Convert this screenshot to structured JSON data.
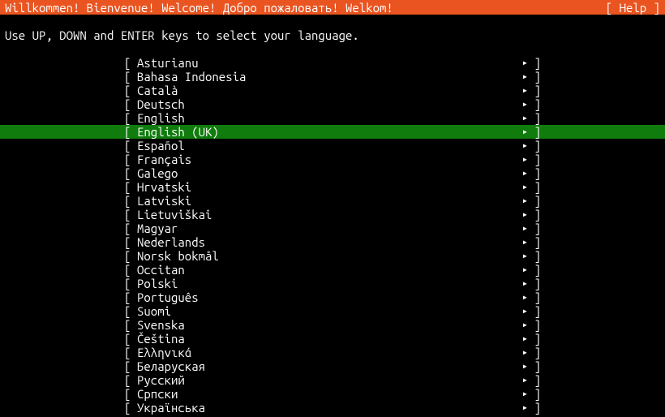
{
  "header": {
    "title": "Willkommen! Bienvenue! Welcome! Добро пожаловать! Welkom!",
    "help_label": "[ Help ]"
  },
  "instruction": "Use UP, DOWN and ENTER keys to select your language.",
  "bracket_open": "[",
  "bracket_close": "]",
  "arrow": "▸",
  "selected_index": 5,
  "languages": [
    {
      "label": "Asturianu"
    },
    {
      "label": "Bahasa Indonesia"
    },
    {
      "label": "Català"
    },
    {
      "label": "Deutsch"
    },
    {
      "label": "English"
    },
    {
      "label": "English (UK)"
    },
    {
      "label": "Español"
    },
    {
      "label": "Français"
    },
    {
      "label": "Galego"
    },
    {
      "label": "Hrvatski"
    },
    {
      "label": "Latviski"
    },
    {
      "label": "Lietuviškai"
    },
    {
      "label": "Magyar"
    },
    {
      "label": "Nederlands"
    },
    {
      "label": "Norsk bokmål"
    },
    {
      "label": "Occitan"
    },
    {
      "label": "Polski"
    },
    {
      "label": "Português"
    },
    {
      "label": "Suomi"
    },
    {
      "label": "Svenska"
    },
    {
      "label": "Čeština"
    },
    {
      "label": "Ελληνικά"
    },
    {
      "label": "Беларуская"
    },
    {
      "label": "Русский"
    },
    {
      "label": "Српски"
    },
    {
      "label": "Українська"
    }
  ]
}
